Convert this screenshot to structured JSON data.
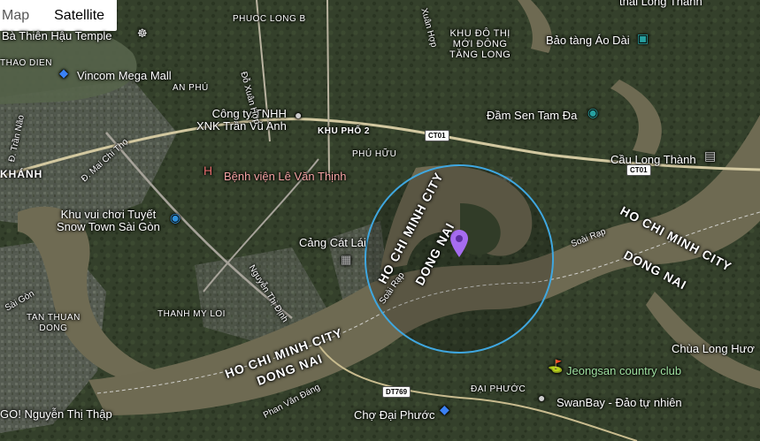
{
  "map_type_control": {
    "map_label": "Map",
    "satellite_label": "Satellite",
    "selected": "Satellite"
  },
  "selected_location": {
    "pin_color": "#a66cf0",
    "circle_color": "#3fa7e0"
  },
  "roads": {
    "ct01_a": "CT01",
    "ct01_b": "CT01",
    "dt769": "DT769"
  },
  "places": {
    "bo_thien_hau": "Bà Thiên Hậu Temple",
    "vincom": "Vincom Mega Mall",
    "cong_ty": "Công ty TNHH\nXNK Trần Vũ Anh",
    "benh_vien": "Bệnh viện Lê Văn Thịnh",
    "snow_town": "Khu vui chơi Tuyết\nSnow Town Sài Gòn",
    "cang_cat_lai": "Cảng Cát Lái",
    "bao_tang": "Bảo tàng Áo Dài",
    "dam_sen": "Đầm Sen Tam Đa",
    "cau_long_thanh": "Cầu Long Thành",
    "cho_dai_phuoc": "Chợ Đại Phước",
    "swanbay": "SwanBay - Đảo tự nhiên",
    "jeongsan": "Jeongsan country club",
    "chua_long_huong": "Chùa Long Hươ",
    "go_nguyen": "GO! Nguyễn Thị Thập",
    "thai_long_thanh": "thái Long Thành"
  },
  "areas": {
    "thao_dien": "THAO DIEN",
    "an_phu": "AN PHÚ",
    "phuoc_long_b": "PHUOC LONG B",
    "khu_do_thi": "KHU ĐÔ THỊ\nMỚI ĐÔNG\nTĂNG LONG",
    "khu_pho_2": "KHU PHỐ 2",
    "phu_huu": "PHÚ HỮU",
    "khanh": "KHÁNH",
    "thanh_my_loi": "THANH MY LOI",
    "tan_thuan_dong": "TAN THUAN\nDONG",
    "dai_phuoc": "ĐẠI PHƯỚC"
  },
  "streets": {
    "do_xuan_hop": "Đỗ Xuân Hợp",
    "tran_nao": "Đ. Trần Não",
    "mai_chi_tho": "Đ. Mai Chí Thọ",
    "nguyen_thi_dinh": "Nguyễn Thị Định",
    "soai_rap_1": "Soài Rạp",
    "soai_rap_2": "Soài Rạp",
    "phan_van_dang": "Phan Văn Đáng",
    "xuan_hop2": "Xuân Hợp",
    "sai_gon": "Sài Gòn"
  },
  "boundaries": {
    "hcm_1": "HO CHI MINH CITY",
    "dongnai_1": "DONG NAI",
    "hcm_2": "HO CHI MINH CITY",
    "dongnai_2": "DONG NAI",
    "hcm_3": "HO CHI MINH CITY",
    "dongnai_3": "DONG NAI"
  }
}
